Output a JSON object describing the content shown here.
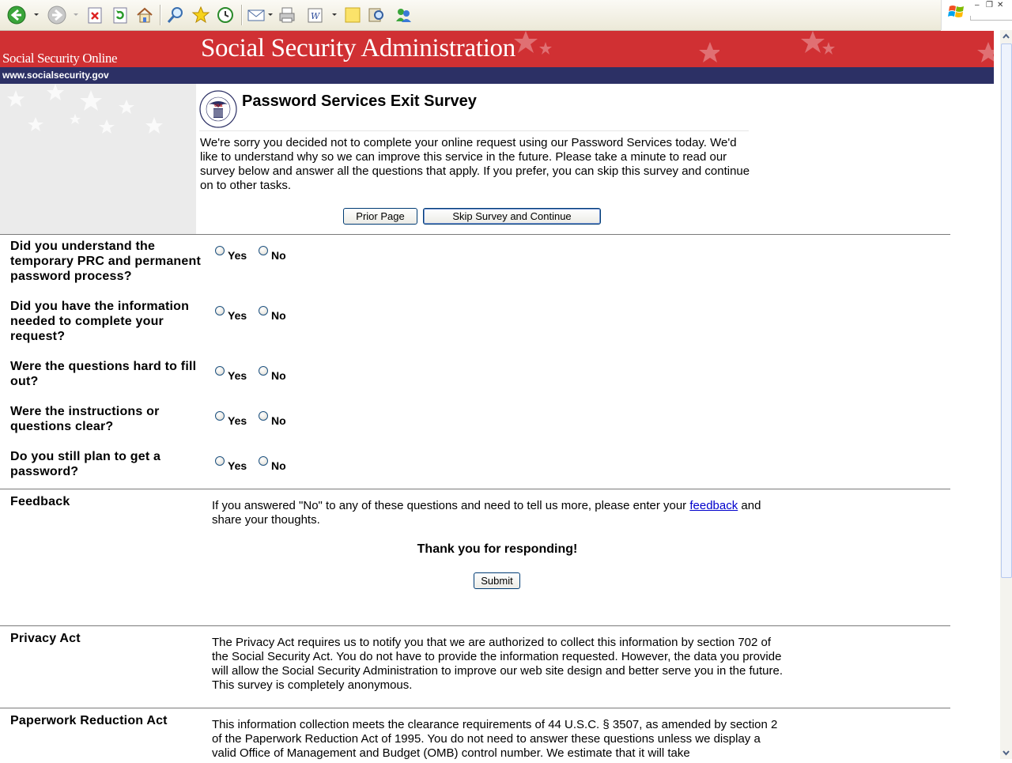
{
  "browser": {
    "toolbar_icons": [
      "back-icon",
      "forward-icon",
      "stop-icon",
      "refresh-icon",
      "home-icon",
      "search-icon",
      "favorites-icon",
      "history-icon",
      "mail-icon",
      "print-icon",
      "edit-icon",
      "note-icon",
      "research-icon",
      "messenger-icon"
    ]
  },
  "header": {
    "site_name": "Social Security Online",
    "agency_name": "Social Security Administration",
    "url": "www.socialsecurity.gov",
    "colors": {
      "banner": "#d03033",
      "url_bar": "#2c3065"
    }
  },
  "intro": {
    "title": "Password Services Exit Survey",
    "text": "We're sorry you decided not to complete your online request using our Password Services today. We'd like to understand why so we can improve this service in the future. Please take a minute to read our survey below and answer all the questions that apply. If you prefer, you can skip this survey and continue on to other tasks.",
    "prior_button": "Prior Page",
    "skip_button": "Skip Survey and Continue"
  },
  "questions": [
    {
      "text": "Did you understand the temporary PRC and permanent password process?",
      "yes": "Yes",
      "no": "No"
    },
    {
      "text": "Did you have the information needed to complete your request?",
      "yes": "Yes",
      "no": "No"
    },
    {
      "text": "Were the questions hard to fill out?",
      "yes": "Yes",
      "no": "No"
    },
    {
      "text": "Were the instructions or questions clear?",
      "yes": "Yes",
      "no": "No"
    },
    {
      "text": "Do you still plan to get a password?",
      "yes": "Yes",
      "no": "No"
    }
  ],
  "feedback": {
    "heading": "Feedback",
    "text_before": "If you answered \"No\" to any of these questions and need to tell us more, please enter your ",
    "link": "feedback",
    "text_after": " and share your thoughts.",
    "thanks": "Thank you for responding!",
    "submit": "Submit"
  },
  "privacy": {
    "heading": "Privacy Act",
    "text": "The Privacy Act requires us to notify you that we are authorized to collect this information by section 702 of the Social Security Act. You do not have to provide the information requested. However, the data you provide will allow the Social Security Administration to improve our web site design and better serve you in the future. This survey is completely anonymous."
  },
  "paperwork": {
    "heading": "Paperwork Reduction Act",
    "text": "This information collection meets the clearance requirements of 44 U.S.C. § 3507, as amended by section 2 of the Paperwork Reduction Act of 1995. You do not need to answer these questions unless we display a valid Office of Management and Budget (OMB) control number. We estimate that it will take"
  }
}
